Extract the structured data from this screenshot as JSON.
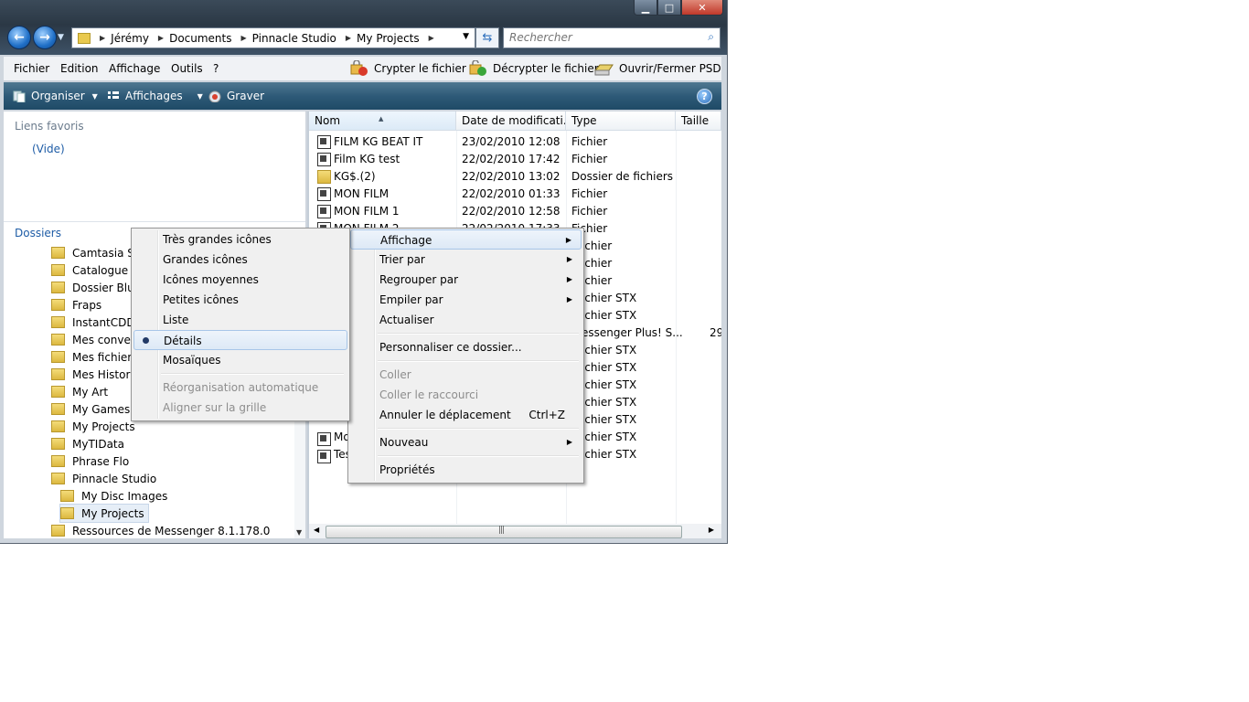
{
  "window": {
    "buttons": {
      "minimize": "▁",
      "maximize": "□",
      "close": "✕"
    }
  },
  "address": {
    "crumbs": [
      "Jérémy",
      "Documents",
      "Pinnacle Studio",
      "My Projects"
    ]
  },
  "search": {
    "placeholder": "Rechercher"
  },
  "menubar": {
    "items": [
      "Fichier",
      "Edition",
      "Affichage",
      "Outils",
      "?"
    ],
    "tools": {
      "encrypt": "Crypter le fichier",
      "decrypt": "Décrypter le fichier",
      "psd": "Ouvrir/Fermer PSD"
    }
  },
  "commandbar": {
    "organize": "Organiser",
    "views": "Affichages",
    "burn": "Graver"
  },
  "navpane": {
    "favorites_title": "Liens favoris",
    "favorites_empty": "(Vide)",
    "folders_title": "Dossiers",
    "tree": [
      "Camtasia Stu",
      "Catalogue Sr",
      "Dossier Bluet",
      "Fraps",
      "InstantCDDV",
      "Mes convers",
      "Mes fichiers",
      "Mes Historiq",
      "My Art",
      "My Games",
      "My Projects",
      "MyTIData",
      "Phrase Flo",
      "Pinnacle Studio",
      "My Disc Images",
      "My Projects",
      "Ressources de Messenger 8.1.178.0"
    ]
  },
  "filelist": {
    "columns": [
      "Nom",
      "Date de modificati...",
      "Type",
      "Taille"
    ],
    "rows": [
      {
        "name": "FILM KG BEAT IT",
        "date": "23/02/2010 12:08",
        "type": "Fichier"
      },
      {
        "name": "Film KG test",
        "date": "22/02/2010 17:42",
        "type": "Fichier"
      },
      {
        "name": "KG$.(2)",
        "date": "22/02/2010 13:02",
        "type": "Dossier de fichiers"
      },
      {
        "name": "MON FILM",
        "date": "22/02/2010 01:33",
        "type": "Fichier"
      },
      {
        "name": "MON FILM 1",
        "date": "22/02/2010 12:58",
        "type": "Fichier"
      }
    ],
    "partial": {
      "row6_name": "MON FILM 2",
      "row6_date": "22/02/2010 17:33",
      "row6_type": "Fichier",
      "type_fragments": [
        "ichier",
        "ichier",
        "ichier",
        "ichier STX",
        "ichier STX",
        "essenger Plus! S...",
        "ichier STX",
        "ichier STX",
        "ichier STX",
        "ichier STX",
        "ichier STX",
        "ichier STX",
        "ichier STX"
      ],
      "size_fragment": "29",
      "name_fragments": [
        "Mo",
        "Tes"
      ]
    }
  },
  "context_menu": {
    "items": [
      {
        "label": "Affichage"
      },
      {
        "label": "Trier par"
      },
      {
        "label": "Regrouper par"
      },
      {
        "label": "Empiler par"
      },
      {
        "label": "Actualiser"
      },
      {
        "label": "Personnaliser ce dossier..."
      },
      {
        "label": "Coller"
      },
      {
        "label": "Coller le raccourci"
      },
      {
        "label": "Annuler le déplacement",
        "shortcut": "Ctrl+Z"
      },
      {
        "label": "Nouveau"
      },
      {
        "label": "Propriétés"
      }
    ]
  },
  "view_submenu": {
    "items": [
      {
        "label": "Très grandes icônes"
      },
      {
        "label": "Grandes icônes"
      },
      {
        "label": "Icônes moyennes"
      },
      {
        "label": "Petites icônes"
      },
      {
        "label": "Liste"
      },
      {
        "label": "Détails"
      },
      {
        "label": "Mosaïques"
      },
      {
        "label": "Réorganisation automatique"
      },
      {
        "label": "Aligner sur la grille"
      }
    ]
  },
  "icons": {
    "back": "arrow-left-icon",
    "forward": "arrow-right-icon",
    "refresh": "refresh-icon",
    "search": "search-icon",
    "help": "help-icon",
    "submenu": "chevron-right-icon"
  },
  "colors": {
    "accent_link": "#1e5ca6",
    "commandbar": "#2e5a78",
    "menu_highlight": "#dde9f6"
  }
}
